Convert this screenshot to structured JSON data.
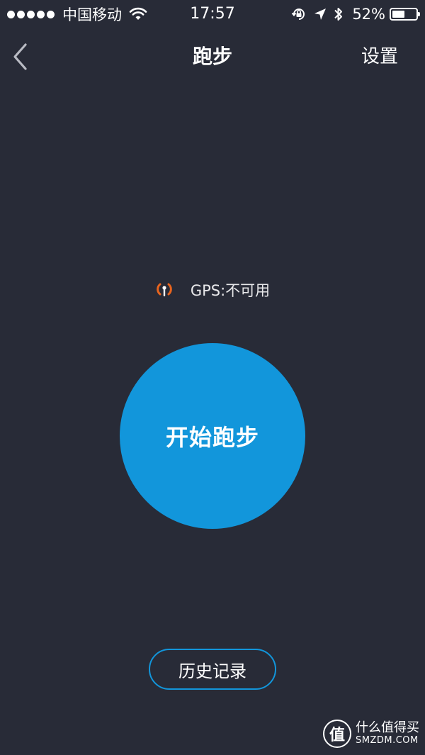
{
  "status_bar": {
    "carrier": "中国移动",
    "time": "17:57",
    "battery_percent": "52%",
    "battery_level": 0.52,
    "icons": [
      "signal-dots-icon",
      "wifi-icon",
      "rotation-lock-icon",
      "location-arrow-icon",
      "bluetooth-icon",
      "battery-icon"
    ]
  },
  "nav": {
    "title": "跑步",
    "settings_label": "设置",
    "back_icon": "chevron-left-icon"
  },
  "gps": {
    "status_text": "GPS:不可用",
    "icon": "gps-signal-icon",
    "icon_color": "#e8641e"
  },
  "actions": {
    "start_label": "开始跑步",
    "history_label": "历史记录"
  },
  "watermark": {
    "logo_char": "值",
    "name": "什么值得买",
    "domain": "SMZDM.COM"
  },
  "colors": {
    "background": "#282b37",
    "accent": "#1296db"
  }
}
